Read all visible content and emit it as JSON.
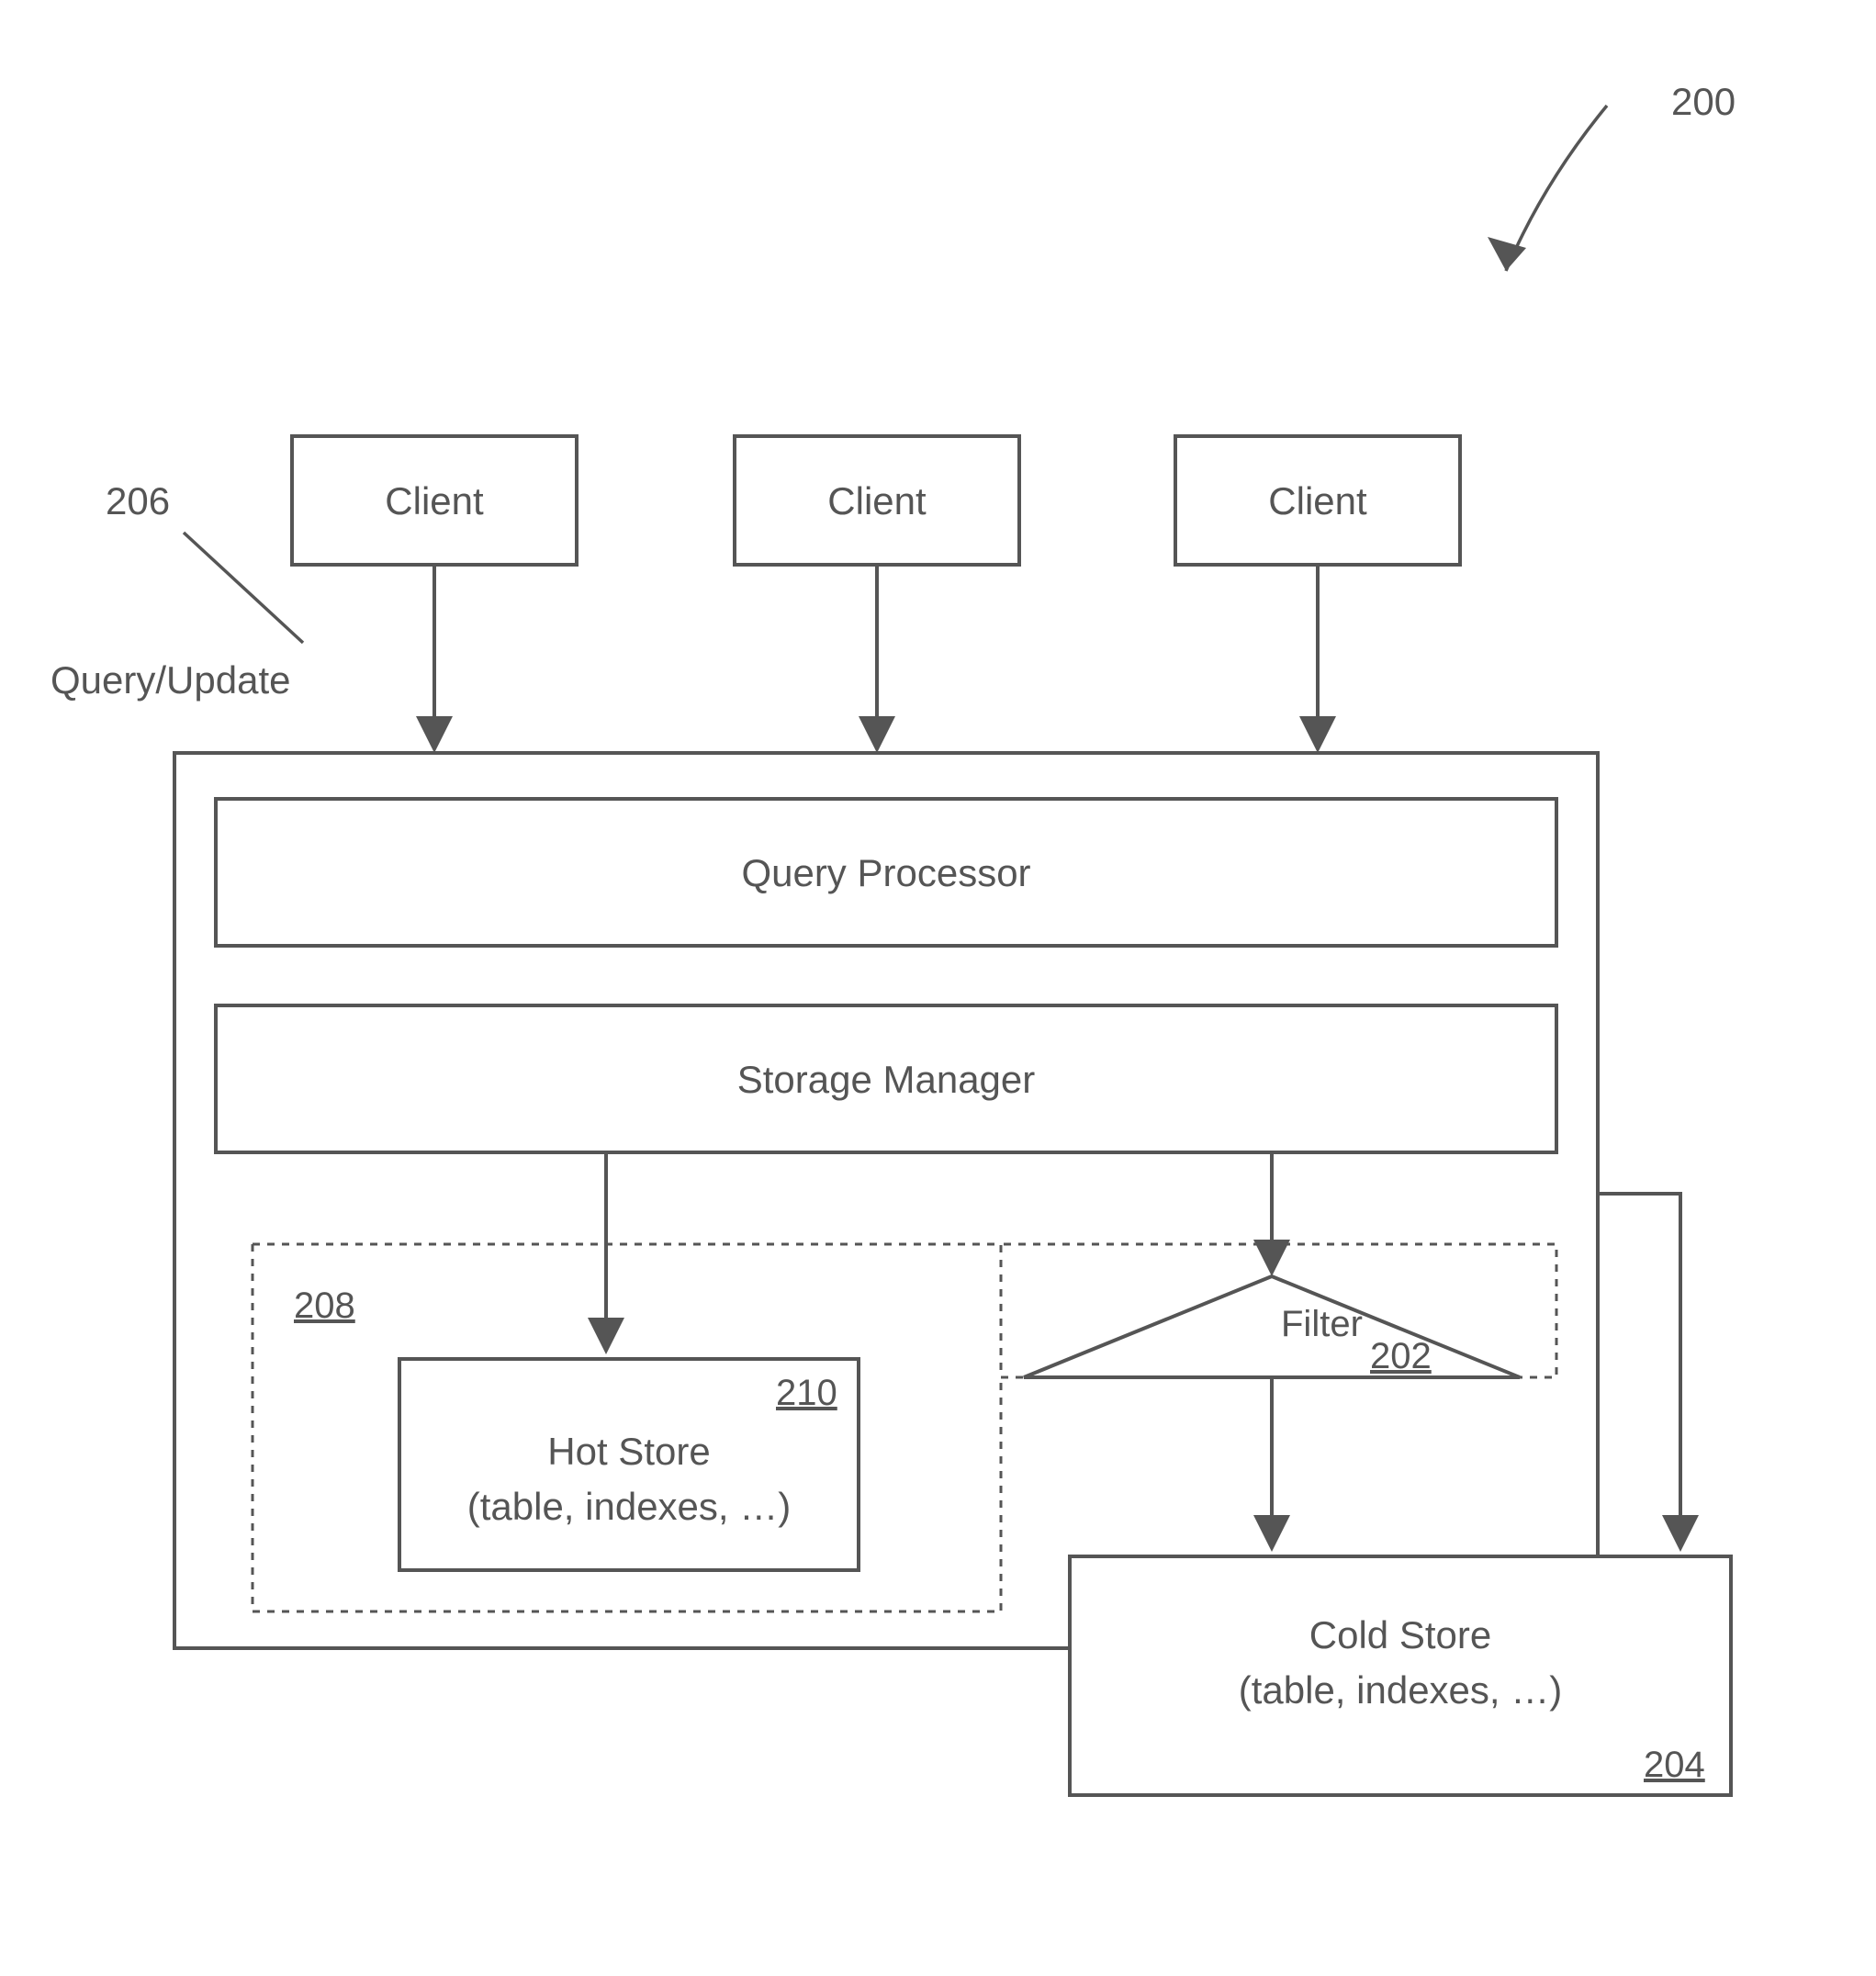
{
  "figure_ref": "200",
  "clients": [
    "Client",
    "Client",
    "Client"
  ],
  "arrow_label_ref": "206",
  "arrow_label": "Query/Update",
  "processor": {
    "query_processor": "Query Processor",
    "storage_manager": "Storage Manager"
  },
  "memory": {
    "ref": "208",
    "hot_store": {
      "title": "Hot Store",
      "subtitle": "(table, indexes, …)",
      "ref": "210"
    },
    "filter": {
      "label": "Filter",
      "ref": "202"
    }
  },
  "cold_store": {
    "title": "Cold Store",
    "subtitle": "(table, indexes, …)",
    "ref": "204"
  }
}
